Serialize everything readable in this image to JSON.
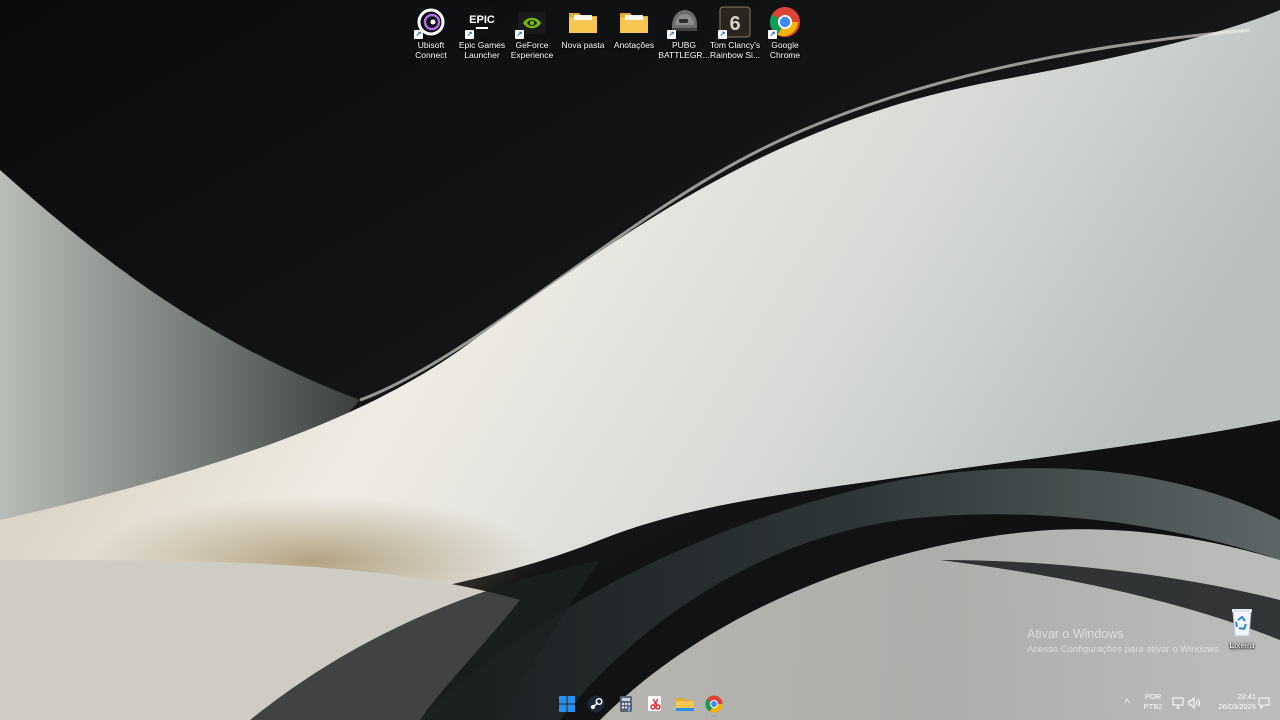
{
  "desktop": {
    "icons": [
      {
        "label": "Ubisoft\nConnect",
        "icon": "ubisoft-icon"
      },
      {
        "label": "Epic Games\nLauncher",
        "icon": "epic-games-icon",
        "logo_text": "EPIC"
      },
      {
        "label": "GeForce\nExperience",
        "icon": "nvidia-icon"
      },
      {
        "label": "Nova pasta",
        "icon": "folder-icon"
      },
      {
        "label": "Anotações",
        "icon": "folder-icon"
      },
      {
        "label": "PUBG\nBATTLEGR...",
        "icon": "pubg-helmet-icon"
      },
      {
        "label": "Tom Clancy's\nRainbow Si...",
        "icon": "rainbow-six-icon",
        "logo_text": "6"
      },
      {
        "label": "Google\nChrome",
        "icon": "chrome-icon"
      }
    ],
    "recycle_bin": {
      "label": "Lixeira",
      "icon": "recycle-bin-icon"
    }
  },
  "watermark": {
    "title": "Ativar o Windows",
    "subtitle": "Acesse Configurações para ativar o Windows."
  },
  "taskbar": {
    "apps": [
      {
        "name": "start",
        "icon": "windows-start-icon"
      },
      {
        "name": "steam",
        "icon": "steam-icon"
      },
      {
        "name": "calculator",
        "icon": "calculator-icon"
      },
      {
        "name": "snipping-tool",
        "icon": "snipping-tool-icon"
      },
      {
        "name": "file-explorer",
        "icon": "file-explorer-icon"
      },
      {
        "name": "chrome",
        "icon": "chrome-icon"
      }
    ],
    "tray": {
      "language": "POR",
      "layout": "PTB2",
      "time": "22:41",
      "date": "26/03/2026"
    }
  },
  "colors": {
    "windows_blue": "#2b8ee8",
    "folder_yellow": "#f4c34a",
    "nvidia_green": "#76b900"
  }
}
